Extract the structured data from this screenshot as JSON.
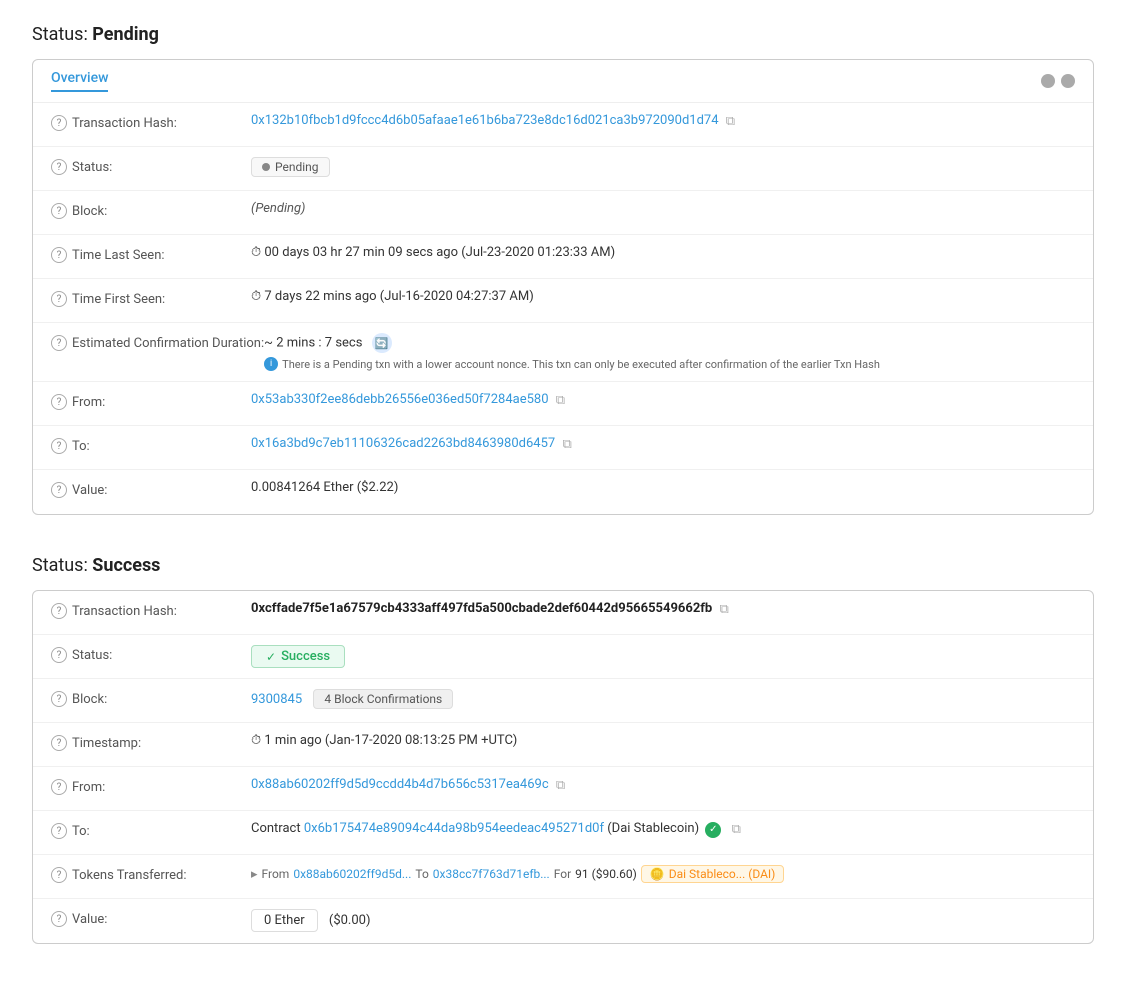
{
  "pending_section": {
    "title": "Status:",
    "title_bold": "Pending",
    "tab_label": "Overview",
    "transaction_hash_label": "Transaction Hash:",
    "transaction_hash_value": "0x132b10fbcb1d9fccc4d6b05afaae1e61b6ba723e8dc16d021ca3b972090d1d74",
    "status_label": "Status:",
    "status_value": "Pending",
    "block_label": "Block:",
    "block_value": "(Pending)",
    "time_last_seen_label": "Time Last Seen:",
    "time_last_seen_value": "⏱ 00 days 03 hr 27 min 09 secs ago (Jul-23-2020 01:23:33 AM)",
    "time_first_seen_label": "Time First Seen:",
    "time_first_seen_value": "⏱ 7 days 22 mins ago (Jul-16-2020 04:27:37 AM)",
    "est_confirmation_label": "Estimated Confirmation Duration:",
    "est_confirmation_value": "~ 2 mins : 7 secs",
    "est_confirmation_note": "There is a Pending txn with a lower account nonce. This txn can only be executed after confirmation of the earlier Txn Hash",
    "from_label": "From:",
    "from_value": "0x53ab330f2ee86debb26556e036ed50f7284ae580",
    "to_label": "To:",
    "to_value": "0x16a3bd9c7eb11106326cad2263bd8463980d6457",
    "value_label": "Value:",
    "value_value": "0.00841264 Ether ($2.22)"
  },
  "success_section": {
    "title": "Status:",
    "title_bold": "Success",
    "transaction_hash_label": "Transaction Hash:",
    "transaction_hash_value": "0xcffade7f5e1a67579cb4333aff497fd5a500cbade2def60442d95665549662fb",
    "status_label": "Status:",
    "status_value": "Success",
    "block_label": "Block:",
    "block_number": "9300845",
    "block_confirmations": "4 Block Confirmations",
    "timestamp_label": "Timestamp:",
    "timestamp_value": "⏱ 1 min ago (Jan-17-2020 08:13:25 PM +UTC)",
    "from_label": "From:",
    "from_value": "0x88ab60202ff9d5d9ccdd4b4d7b656c5317ea469c",
    "to_label": "To:",
    "to_prefix": "Contract",
    "to_address": "0x6b175474e89094c44da98b954eedeac495271d0f",
    "to_name": "(Dai Stablecoin)",
    "tokens_transferred_label": "Tokens Transferred:",
    "tokens_from": "0x88ab60202ff9d5d...",
    "tokens_to": "0x38cc7f763d71efb...",
    "tokens_for_amount": "91 ($90.60)",
    "tokens_name": "Dai Stableco... (DAI)",
    "value_label": "Value:",
    "value_ether": "0 Ether",
    "value_usd": "($0.00)"
  },
  "icons": {
    "question": "?",
    "copy": "⧉",
    "clock": "⏱",
    "spinner": "⟳",
    "check": "✓",
    "info": "i",
    "arrow": "▸"
  }
}
